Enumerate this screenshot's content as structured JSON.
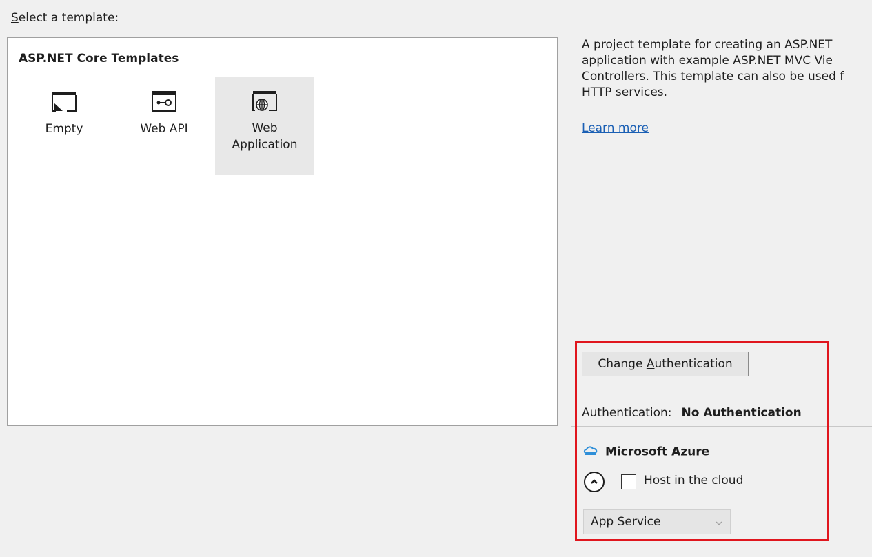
{
  "header": {
    "label_prefix": "S",
    "label_rest": "elect a template:"
  },
  "templates": {
    "group_title": "ASP.NET Core Templates",
    "items": [
      {
        "label_line1": "Empty",
        "label_line2": "",
        "icon": "empty-template-icon"
      },
      {
        "label_line1": "Web API",
        "label_line2": "",
        "icon": "web-api-template-icon"
      },
      {
        "label_line1": "Web",
        "label_line2": "Application",
        "icon": "web-application-template-icon",
        "selected": true
      }
    ]
  },
  "description": {
    "line1": "A project template for creating an ASP.NET",
    "line2": "application with example ASP.NET MVC Vie",
    "line3": "Controllers. This template can also be used f",
    "line4": "HTTP services.",
    "learn_more": "Learn more"
  },
  "auth": {
    "button_prefix": "Change ",
    "button_accel": "A",
    "button_rest": "uthentication",
    "label": "Authentication:",
    "value": "No Authentication"
  },
  "azure": {
    "title": "Microsoft Azure",
    "icon": "azure-cloud-icon",
    "host_accel": "H",
    "host_rest": "ost in the cloud",
    "host_checked": false,
    "service_select_value": "App Service"
  },
  "colors": {
    "highlight": "#e0161e",
    "link": "#1a5fb4",
    "azure": "#2f8fd8"
  }
}
